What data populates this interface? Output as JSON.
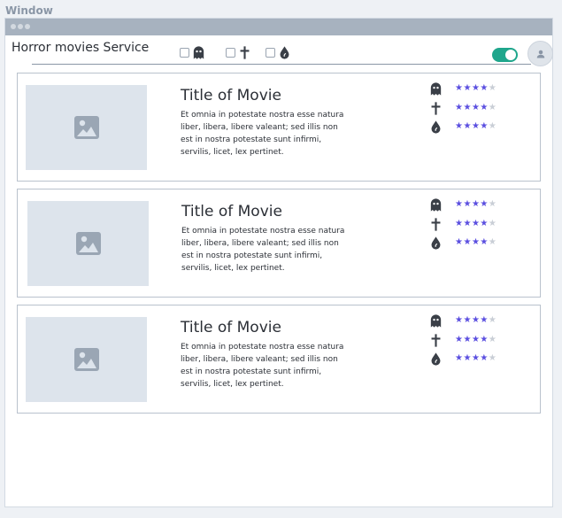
{
  "window": {
    "label": "Window"
  },
  "header": {
    "title": "Horror movies Service",
    "filters": [
      {
        "icon": "ghost-icon",
        "checked": false
      },
      {
        "icon": "cross-icon",
        "checked": false
      },
      {
        "icon": "blood-drop-icon",
        "checked": false
      }
    ],
    "toggle_on": true,
    "avatar_icon": "user-icon"
  },
  "colors": {
    "accent_toggle": "#1fa68c",
    "star_filled": "#5b4fe0",
    "star_empty": "#c9ced6"
  },
  "movies": [
    {
      "title": "Title of Movie",
      "description": "Et omnia in potestate nostra esse natura liber, libera, libere valeant; sed illis non est in nostra potestate sunt infirmi, servilis, licet, lex pertinet.",
      "ratings": [
        {
          "icon": "ghost-icon",
          "stars": 4,
          "max": 5
        },
        {
          "icon": "cross-icon",
          "stars": 4,
          "max": 5
        },
        {
          "icon": "blood-drop-icon",
          "stars": 4,
          "max": 5
        }
      ]
    },
    {
      "title": "Title of Movie",
      "description": "Et omnia in potestate nostra esse natura liber, libera, libere valeant; sed illis non est in nostra potestate sunt infirmi, servilis, licet, lex pertinet.",
      "ratings": [
        {
          "icon": "ghost-icon",
          "stars": 4,
          "max": 5
        },
        {
          "icon": "cross-icon",
          "stars": 4,
          "max": 5
        },
        {
          "icon": "blood-drop-icon",
          "stars": 4,
          "max": 5
        }
      ]
    },
    {
      "title": "Title of Movie",
      "description": "Et omnia in potestate nostra esse natura liber, libera, libere valeant; sed illis non est in nostra potestate sunt infirmi, servilis, licet, lex pertinet.",
      "ratings": [
        {
          "icon": "ghost-icon",
          "stars": 4,
          "max": 5
        },
        {
          "icon": "cross-icon",
          "stars": 4,
          "max": 5
        },
        {
          "icon": "blood-drop-icon",
          "stars": 4,
          "max": 5
        }
      ]
    }
  ]
}
